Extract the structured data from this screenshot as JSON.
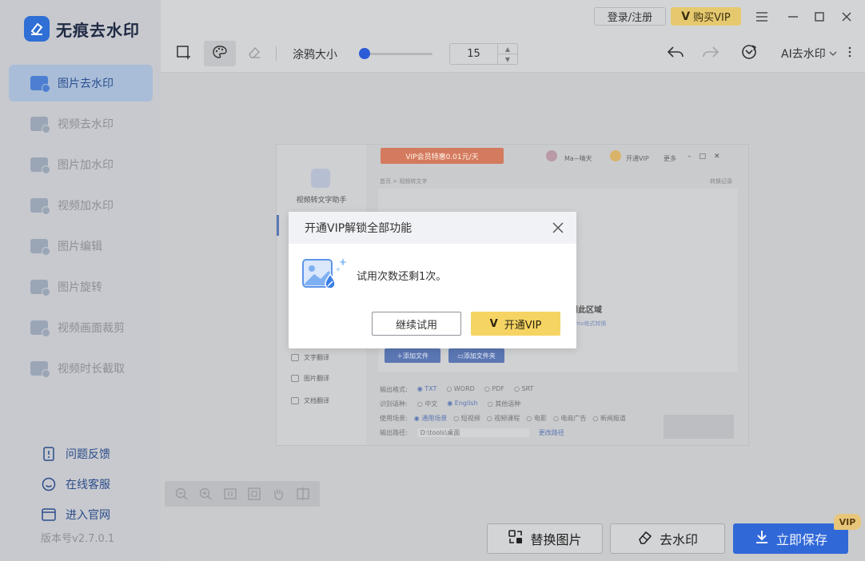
{
  "app": {
    "name": "无痕去水印",
    "version": "版本号v2.7.0.1",
    "accent": "#2b5bd6"
  },
  "sidebar": {
    "items": [
      {
        "label": "图片去水印",
        "icon": "image-watermark-remove-icon",
        "active": true
      },
      {
        "label": "视频去水印",
        "icon": "video-watermark-remove-icon"
      },
      {
        "label": "图片加水印",
        "icon": "image-watermark-add-icon"
      },
      {
        "label": "视频加水印",
        "icon": "video-watermark-add-icon"
      },
      {
        "label": "图片编辑",
        "icon": "image-edit-icon"
      },
      {
        "label": "图片旋转",
        "icon": "image-rotate-icon"
      },
      {
        "label": "视频画面裁剪",
        "icon": "video-crop-icon"
      },
      {
        "label": "视频时长截取",
        "icon": "video-trim-icon"
      }
    ],
    "footer": [
      {
        "label": "问题反馈",
        "icon": "feedback-icon"
      },
      {
        "label": "在线客服",
        "icon": "support-icon"
      },
      {
        "label": "进入官网",
        "icon": "website-icon"
      }
    ]
  },
  "titlebar": {
    "login": "登录/注册",
    "buy_vip": "购买VIP"
  },
  "toolbar": {
    "brush_label": "涂鸦大小",
    "brush_size": "15",
    "brush_fraction": 0.06,
    "ai_label": "AI去水印"
  },
  "embedded": {
    "promo": "VIP会员特惠0.01元/天",
    "user": "Ma~晴天",
    "open_vip": "开通VIP",
    "more": "更多",
    "app_name": "视频转文字助手",
    "breadcrumb": "首页 > 视频转文字",
    "history": "转换记录",
    "drop_text": "文件到此区域",
    "formats": "b, .vob, .wmv格式转换",
    "side_items": [
      "文字翻译",
      "图片翻译",
      "文档翻译"
    ],
    "add_file": "添加文件",
    "add_folder": "添加文件夹",
    "row_output_label": "输出格式:",
    "row_output": [
      "TXT",
      "WORD",
      "PDF",
      "SRT"
    ],
    "row_lang_label": "识别语种:",
    "row_lang": [
      "中文",
      "English",
      "其他语种"
    ],
    "row_scene_label": "使用场景:",
    "row_scene": [
      "通用场景",
      "短视频",
      "视频课程",
      "电影",
      "电商广告",
      "新闻报道"
    ],
    "row_path_label": "输出路径:",
    "row_path": "D:\\tools\\桌面",
    "row_change": "更改路径"
  },
  "dialog": {
    "title": "开通VIP解锁全部功能",
    "message": "试用次数还剩1次。",
    "trial": "继续试用",
    "vip": "开通VIP"
  },
  "actions": {
    "replace": "替换图片",
    "remove": "去水印",
    "save": "立即保存",
    "vip_badge": "VIP"
  }
}
